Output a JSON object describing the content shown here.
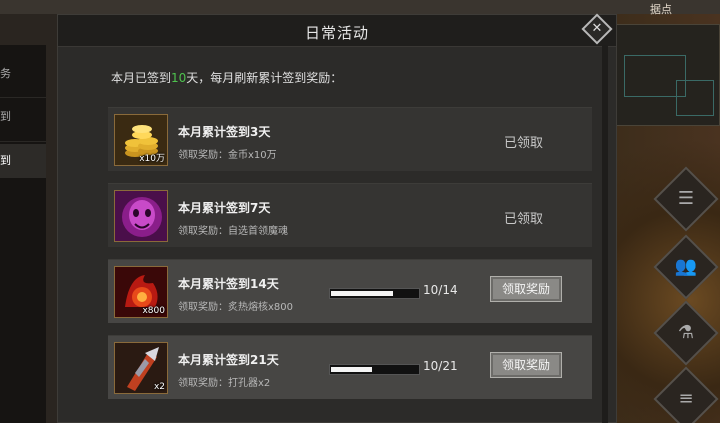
{
  "header": {
    "title": "日常活动",
    "close_icon": "close-icon"
  },
  "map": {
    "label": "据点"
  },
  "tabs": [
    {
      "label": "务",
      "active": false
    },
    {
      "label": "到",
      "active": false
    },
    {
      "label": "到",
      "active": true
    }
  ],
  "summary": {
    "prefix": "本月已签到",
    "days": "10",
    "suffix": "天，每月刷新累计签到奖励："
  },
  "rewards": [
    {
      "title": "本月累计签到3天",
      "reward": "领取奖励：金币x10万",
      "qty": "x10万",
      "icon": "gold-coins-icon",
      "status": "已领取"
    },
    {
      "title": "本月累计签到7天",
      "reward": "领取奖励：自选首领魔魂",
      "qty": "",
      "icon": "demon-soul-icon",
      "status": "已领取"
    },
    {
      "title": "本月累计签到14天",
      "reward": "领取奖励：炙热熔核x800",
      "qty": "x800",
      "icon": "fire-core-icon",
      "progress_text": "10/14",
      "progress": 0.714,
      "button": "领取奖励"
    },
    {
      "title": "本月累计签到21天",
      "reward": "领取奖励：打孔器x2",
      "qty": "x2",
      "icon": "drill-tool-icon",
      "progress_text": "10/21",
      "progress": 0.476,
      "button": "领取奖励"
    }
  ],
  "colors": {
    "highlight_green": "#4ec24e",
    "panel": "#2c2b29",
    "button": "#8a8986"
  }
}
